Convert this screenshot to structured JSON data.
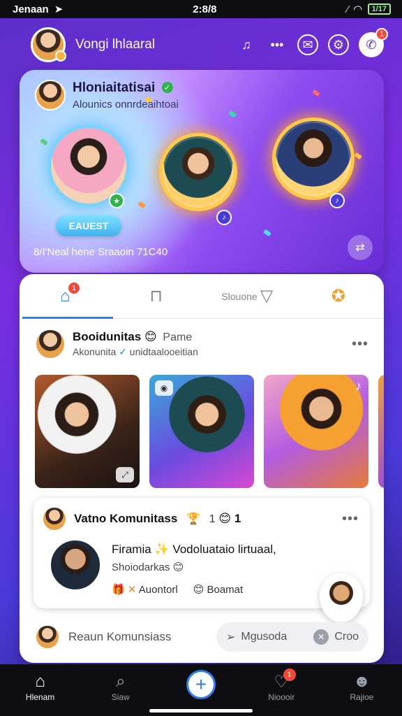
{
  "status_bar": {
    "carrier": "Jenaan",
    "time": "2:8/8",
    "battery": "1/17"
  },
  "header": {
    "user_name": "Vongi lhlaaral",
    "notification_count": "1"
  },
  "hero": {
    "title": "Hloniaitatisai",
    "subtitle": "Alounics",
    "subtitle_extra": "onnrdeaihtoai",
    "button_label": "EAUEST",
    "footer_text": "8/I'Neal hene Sraaoin 71C40"
  },
  "tabs": [
    {
      "label": "",
      "icon": "home-icon",
      "badge": "1"
    },
    {
      "label": "",
      "icon": "lock-icon"
    },
    {
      "label": "Slouone",
      "icon": "trash-icon"
    },
    {
      "label": "",
      "icon": "award-icon"
    }
  ],
  "post": {
    "title": "Booidunitas",
    "title_extra": "Pame",
    "subtitle": "Akonunita",
    "subtitle_extra": "unidtaalooeitian"
  },
  "card2": {
    "title": "Vatno Komunitass",
    "title_extra": "1",
    "title_extra2": "1",
    "line1": "Firamia",
    "line1_extra": "Vodoluataio lirtuaal,",
    "line2": "Shoiodarkas",
    "action1": "Auontorl",
    "action2": "Boamat"
  },
  "comment": {
    "label": "Reaun Komunsiass",
    "button_label": "Mgusoda",
    "button_extra": "Croo"
  },
  "bottom_nav": [
    {
      "label": "Hlenam",
      "icon": "home-icon"
    },
    {
      "label": "Siaw",
      "icon": "search-icon"
    },
    {
      "label": "",
      "icon": "plus-icon"
    },
    {
      "label": "Nioooir",
      "icon": "heart-icon",
      "badge": "1"
    },
    {
      "label": "Rajioe",
      "icon": "user-icon"
    }
  ]
}
